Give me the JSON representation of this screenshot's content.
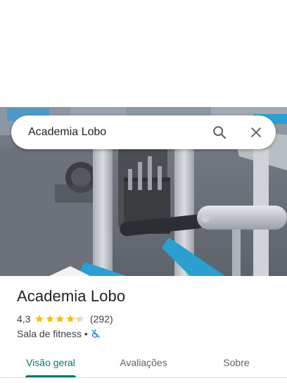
{
  "search": {
    "query": "Academia Lobo"
  },
  "place": {
    "name": "Academia Lobo",
    "rating": "4,3",
    "rating_stars": 4.3,
    "reviews": "(292)",
    "category": "Sala de fitness",
    "separator": "•",
    "accessibility_icon": "not-wheelchair-accessible-icon"
  },
  "tabs": [
    {
      "label": "Visão geral",
      "active": true
    },
    {
      "label": "Avaliações",
      "active": false
    },
    {
      "label": "Sobre",
      "active": false
    }
  ],
  "colors": {
    "accent": "#00796b",
    "star": "#fbbc04",
    "accessibility": "#1a73e8"
  }
}
